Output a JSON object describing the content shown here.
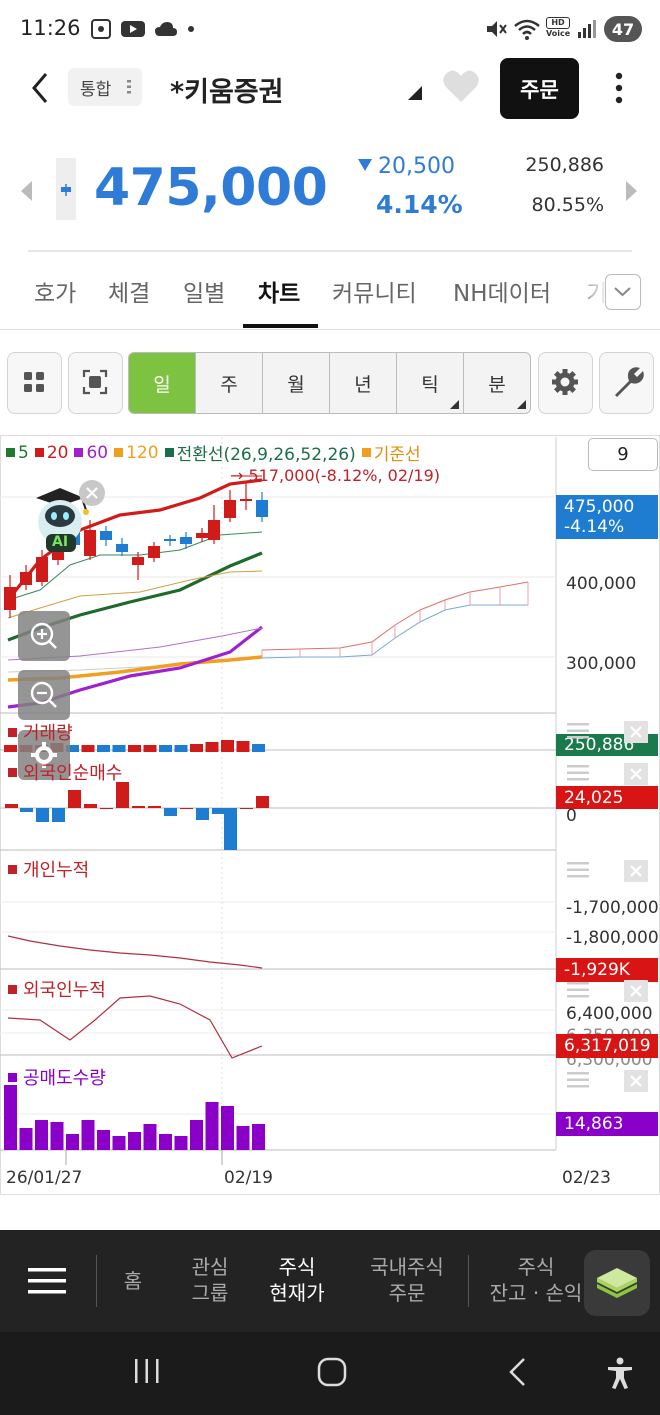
{
  "status_bar": {
    "time": "11:26",
    "battery": "47",
    "network": "HD Voice"
  },
  "header": {
    "filter_label": "통합",
    "stock_name": "*키움증권",
    "order_label": "주문"
  },
  "quote": {
    "price": "475,000",
    "change_amount": "20,500",
    "change_percent": "4.14%",
    "volume": "250,886",
    "volume_ratio": "80.55%",
    "colors": {
      "down": "#2e7bd8",
      "up": "#c0222a"
    }
  },
  "tabs": [
    {
      "label": "호가"
    },
    {
      "label": "체결"
    },
    {
      "label": "일별"
    },
    {
      "label": "차트",
      "active": true
    },
    {
      "label": "커뮤니티"
    },
    {
      "label": "NH데이터"
    },
    {
      "label": "기"
    }
  ],
  "toolbar": {
    "periods": [
      {
        "label": "일",
        "active": true,
        "menu": false
      },
      {
        "label": "주",
        "active": false,
        "menu": false
      },
      {
        "label": "월",
        "active": false,
        "menu": false
      },
      {
        "label": "년",
        "active": false,
        "menu": false
      },
      {
        "label": "틱",
        "active": false,
        "menu": true
      },
      {
        "label": "분",
        "active": false,
        "menu": true
      }
    ]
  },
  "chart": {
    "legend": [
      {
        "label": "5",
        "color": "#1e7a2e"
      },
      {
        "label": "20",
        "color": "#d01b1b"
      },
      {
        "label": "60",
        "color": "#a020d0"
      },
      {
        "label": "120",
        "color": "#f0a020"
      },
      {
        "label": "전환선(26,9,26,52,26)",
        "color": "#1b6e4b"
      },
      {
        "label": "기준선",
        "color": "#f0a020"
      }
    ],
    "count_box": "9",
    "ai_label": "AI",
    "high_callout": "517,000(-8.12%, 02/19)",
    "current_price_tag": {
      "price": "475,000",
      "pct": "-4.14%"
    },
    "price_axis": [
      "400,000",
      "300,000"
    ],
    "panels": {
      "volume": {
        "title": "거래량",
        "tag": "250,886"
      },
      "foreign_net": {
        "title": "외국인순매수",
        "tag": "24,025",
        "axis_zero": "0"
      },
      "retail_cum": {
        "title": "개인누적",
        "axis": [
          "-1,700,000",
          "-1,800,000"
        ],
        "tag": "-1,929K"
      },
      "foreign_cum": {
        "title": "외국인누적",
        "axis": [
          "6,400,000",
          "6,350,000",
          "6,300,000"
        ],
        "tag": "6,317,019"
      },
      "short_sell": {
        "title": "공매도수량",
        "tag": "14,863"
      }
    },
    "date_axis": [
      "26/01/27",
      "02/19",
      "02/23"
    ],
    "colors": {
      "up": "#d01b1b",
      "down": "#1e7dd0",
      "short": "#8a00c8"
    }
  },
  "bottom_nav": {
    "items": [
      {
        "label": "홈",
        "active": false
      },
      {
        "label": "관심\n그룹",
        "active": false
      },
      {
        "label": "주식\n현재가",
        "active": true
      },
      {
        "label": "국내주식\n주문",
        "active": false
      },
      {
        "label": "주식\n잔고 · 손익",
        "active": false
      }
    ]
  }
}
